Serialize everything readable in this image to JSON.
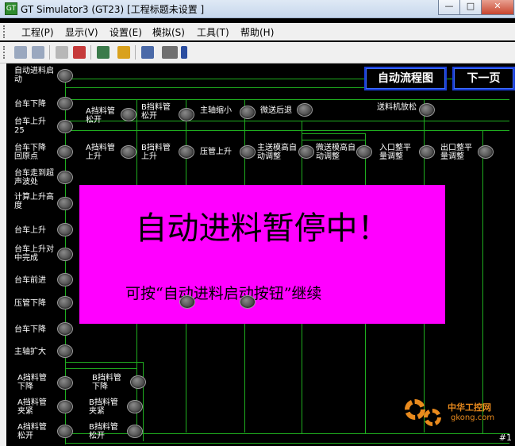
{
  "window": {
    "title": "GT Simulator3 (GT23)  [工程标题未设置 ]",
    "app_icon": "GT",
    "controls": {
      "minimize": "—",
      "maximize": "□",
      "close": "✕"
    }
  },
  "menu": [
    "工程(P)",
    "显示(V)",
    "设置(E)",
    "模拟(S)",
    "工具(T)",
    "帮助(H)"
  ],
  "toolbar": [
    "undo-icon",
    "redo-icon",
    "read-icon",
    "stop-icon",
    "monitor-icon",
    "device-icon",
    "keyboard-icon"
  ],
  "screen": {
    "nav": {
      "auto_flow": "自动流程图",
      "next_page": "下一页"
    },
    "left_labels": [
      "自动进料启动",
      "台车下降",
      "台车上升25",
      "台车下降回原点",
      "台车走到超声波处",
      "计算上升高度",
      "台车上升",
      "台车上升对中完成",
      "台车前进",
      "压管下降",
      "台车下降",
      "主轴扩大",
      "A挡料管下降",
      "A挡料管夹紧",
      "A挡料管松开"
    ],
    "row1": [
      "A挡料管松开",
      "B挡料管松开",
      "主轴缩小",
      "微送后退",
      "送料机放松"
    ],
    "row2": [
      "A挡料管上升",
      "B挡料管上升",
      "压管上升",
      "主送模高自动调整",
      "微送模高自动调整",
      "入口整平量调整",
      "出口整平量调整"
    ],
    "bottom_col2": [
      "B挡料管下降",
      "B挡料管夹紧",
      "B挡料管松开"
    ],
    "popup": {
      "title": "自动进料暂停中！",
      "message": "可按“自动进料启动按钮”继续"
    },
    "page_number": "#1",
    "watermark": {
      "line1": "中华工控网",
      "line2": "gkong.com"
    }
  },
  "colors": {
    "popup_bg": "#ff00ff",
    "line": "#1fae1f",
    "nav_border": "#1b3fd8"
  }
}
